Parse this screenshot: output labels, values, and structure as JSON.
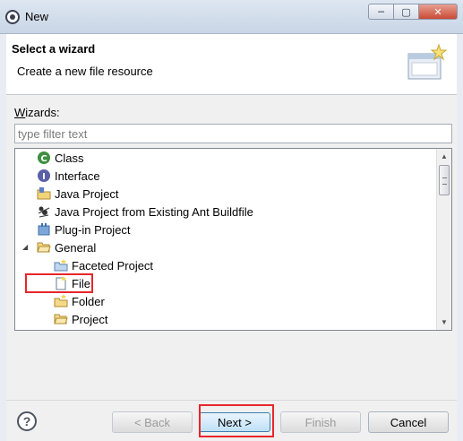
{
  "window": {
    "title": "New",
    "minimize_label": "─",
    "maximize_label": "▢",
    "close_label": "✕"
  },
  "header": {
    "title": "Select a wizard",
    "description": "Create a new file resource"
  },
  "wizards_label": "izards:",
  "wizards_mnemonic": "W",
  "filter": {
    "value": "",
    "placeholder": "type filter text"
  },
  "tree": {
    "items": [
      {
        "label": "Class",
        "icon": "class-icon"
      },
      {
        "label": "Interface",
        "icon": "interface-icon"
      },
      {
        "label": "Java Project",
        "icon": "java-project-icon"
      },
      {
        "label": "Java Project from Existing Ant Buildfile",
        "icon": "ant-icon"
      },
      {
        "label": "Plug-in Project",
        "icon": "plugin-project-icon"
      },
      {
        "label": "General",
        "icon": "folder-open-icon",
        "expanded": true
      },
      {
        "label": "Faceted Project",
        "icon": "faceted-project-icon"
      },
      {
        "label": "File",
        "icon": "new-file-icon",
        "highlighted": true
      },
      {
        "label": "Folder",
        "icon": "new-folder-icon"
      },
      {
        "label": "Project",
        "icon": "project-icon"
      }
    ]
  },
  "footer": {
    "help_label": "?",
    "back_label": "< Back",
    "back_mnemonic": "B",
    "next_label": "Next >",
    "next_mnemonic": "N",
    "finish_label": "Finish",
    "finish_mnemonic": "F",
    "cancel_label": "Cancel"
  },
  "colors": {
    "highlight_border": "#e8262b",
    "window_bg": "#f0f0f0",
    "titlebar": "#c9d6e6"
  }
}
